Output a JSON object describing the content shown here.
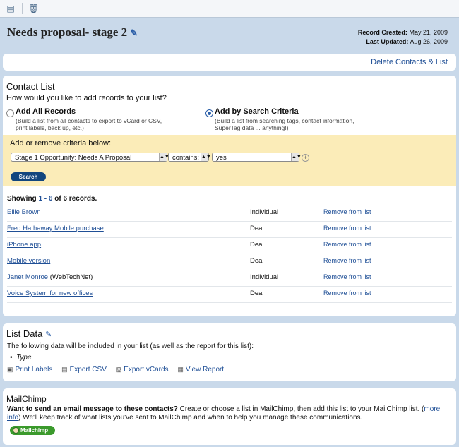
{
  "toolbar": {
    "icons": [
      "print-icon",
      "trash-icon"
    ]
  },
  "header": {
    "title": "Needs proposal- stage 2",
    "record_created_label": "Record Created:",
    "record_created": "May 21, 2009",
    "last_updated_label": "Last Updated:",
    "last_updated": "Aug 26, 2009"
  },
  "actions": {
    "delete_label": "Delete Contacts & List"
  },
  "contact_list": {
    "title": "Contact List",
    "question": "How would you like to add records to your list?",
    "option_all": {
      "label": "Add All Records",
      "desc_line1": "(Build a list from all contacts to export to vCard or CSV,",
      "desc_line2": "print labels, back up, etc.)",
      "selected": false
    },
    "option_search": {
      "label": "Add by Search Criteria",
      "desc_line1": "(Build a list from searching tags, contact information,",
      "desc_line2": "SuperTag data ... anything!)",
      "selected": true
    },
    "criteria": {
      "label": "Add or remove criteria below:",
      "field": "Stage 1 Opportunity: Needs A Proposal",
      "operator": "contains:",
      "value": "yes",
      "search_label": "Search"
    },
    "showing": {
      "prefix": "Showing ",
      "range": "1 - 6",
      "suffix": " of 6 records."
    },
    "remove_label": "Remove from list",
    "records": [
      {
        "name": "Ellie Brown",
        "extra": "",
        "type": "Individual"
      },
      {
        "name": "Fred Hathaway Mobile purchase",
        "extra": "",
        "type": "Deal"
      },
      {
        "name": "iPhone app",
        "extra": "",
        "type": "Deal"
      },
      {
        "name": "Mobile version",
        "extra": "",
        "type": "Deal"
      },
      {
        "name": "Janet Monroe",
        "extra": " (WebTechNet)",
        "type": "Individual"
      },
      {
        "name": "Voice System for new offices",
        "extra": "",
        "type": "Deal"
      }
    ]
  },
  "list_data": {
    "title": "List Data",
    "description": "The following data will be included in your list (as well as the report for this list):",
    "bullet": "Type",
    "links": {
      "print_labels": "Print Labels",
      "export_csv": "Export CSV",
      "export_vcards": "Export vCards",
      "view_report": "View Report"
    }
  },
  "mailchimp": {
    "title": "MailChimp",
    "lead": "Want to send an email message to these contacts?",
    "body1": " Create or choose a list in MailChimp, then add this list to your MailChimp list. (",
    "more_info": "more info",
    "body2": ") We'll keep track of what lists you've sent to MailChimp and when to help you manage these communications.",
    "button_label": "Mailchimp"
  },
  "colors": {
    "page_bg": "#c9d9ea",
    "link": "#1f4f96",
    "criteria_bg": "#fbecb8",
    "search_button": "#12467e",
    "mailchimp_button": "#3b9a2c"
  }
}
